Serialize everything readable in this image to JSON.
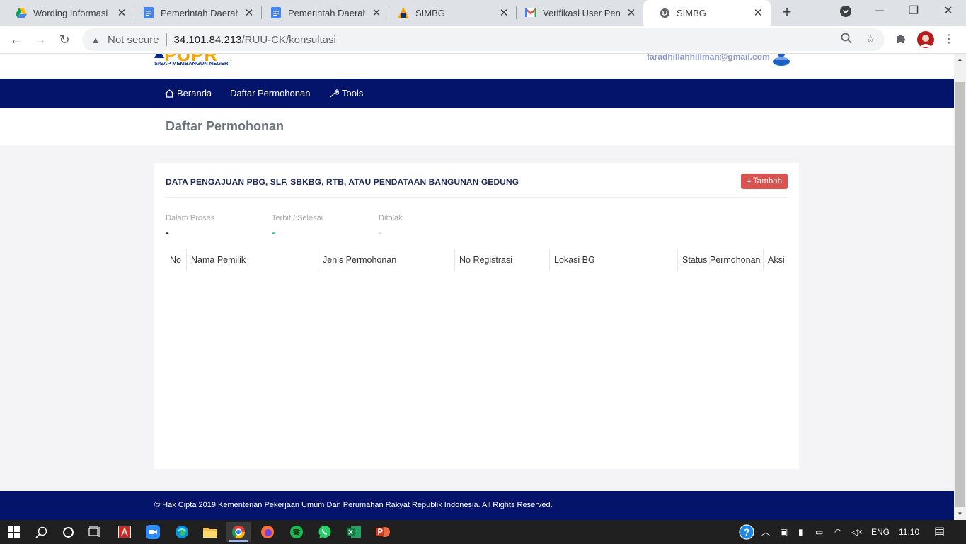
{
  "browser": {
    "tabs": [
      {
        "title": "Wording Informasi S",
        "favicon": "google-drive-icon",
        "active": false
      },
      {
        "title": "Pemerintah Daerah",
        "favicon": "google-docs-icon",
        "active": false
      },
      {
        "title": "Pemerintah Daerah",
        "favicon": "google-docs-icon",
        "active": false
      },
      {
        "title": "SIMBG",
        "favicon": "pupr-icon",
        "active": false
      },
      {
        "title": "Verifikasi User Peng",
        "favicon": "gmail-icon",
        "active": false
      },
      {
        "title": "SIMBG",
        "favicon": "globe-icon",
        "active": true
      }
    ],
    "security_label": "Not secure",
    "url_host": "34.101.84.213",
    "url_path": "/RUU-CK/konsultasi"
  },
  "site": {
    "logo_word": "PUPR",
    "logo_tagline": "SIGAP MEMBANGUN NEGERI",
    "user_email": "faradhillahhillman@gmail.com",
    "nav": [
      {
        "label": "Beranda",
        "icon": "home-icon"
      },
      {
        "label": "Daftar Permohonan",
        "icon": ""
      },
      {
        "label": "Tools",
        "icon": "wrench-icon"
      }
    ],
    "page_title": "Daftar Permohonan",
    "card": {
      "title": "DATA PENGAJUAN PBG, SLF, SBKBG, RTB, ATAU PENDATAAN BANGUNAN GEDUNG",
      "add_button": "Tambah",
      "stats": [
        {
          "label": "Dalam Proses",
          "value": "-",
          "color": "#222222"
        },
        {
          "label": "Terbit / Selesai",
          "value": "-",
          "color": "#20c997"
        },
        {
          "label": "Ditolak",
          "value": "-",
          "color": "#d9d9d9"
        }
      ],
      "columns": [
        "No",
        "Nama Pemilik",
        "Jenis Permohonan",
        "No Registrasi",
        "Lokasi BG",
        "Status Permohonan",
        "Aksi"
      ],
      "rows": []
    },
    "footer": "© Hak Cipta 2019 Kementerian Pekerjaan Umum Dan Perumahan Rakyat Republik Indonesia. All Rights Reserved."
  },
  "taskbar": {
    "language": "ENG",
    "time": "11:10"
  },
  "colors": {
    "navy": "#04146b",
    "danger": "#d9534f",
    "logo_yellow": "#f5a400"
  }
}
